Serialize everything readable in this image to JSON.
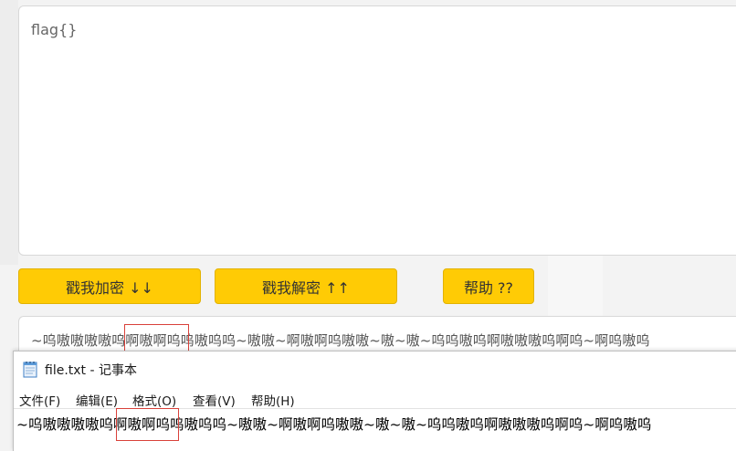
{
  "input": {
    "text": "flag{}"
  },
  "buttons": {
    "encrypt_label": "戳我加密 ↓↓",
    "decrypt_label": "戳我解密 ↑↑",
    "help_label": "帮助 ??"
  },
  "output": {
    "text": "~呜嗷嗷嗷嗷呜啊嗷啊呜呜嗷呜呜~嗷嗷~啊嗷啊呜嗷嗷~嗷~嗷~呜呜嗷呜啊嗷嗷嗷呜啊呜~啊呜嗷呜"
  },
  "notepad": {
    "title": "file.txt - 记事本",
    "icon": "notepad-icon",
    "menu": {
      "file": "文件(F)",
      "edit": "编辑(E)",
      "format": "格式(O)",
      "view": "查看(V)",
      "help": "帮助(H)"
    },
    "content": "~呜嗷嗷嗷嗷呜啊嗷啊呜呜嗷呜呜~嗷嗷~啊嗷啊呜嗷嗷~嗷~嗷~呜呜嗷呜啊嗷嗷嗷呜啊呜~啊呜嗷呜"
  },
  "colors": {
    "button_bg": "#ffcb05",
    "highlight_border": "#d9413a"
  }
}
